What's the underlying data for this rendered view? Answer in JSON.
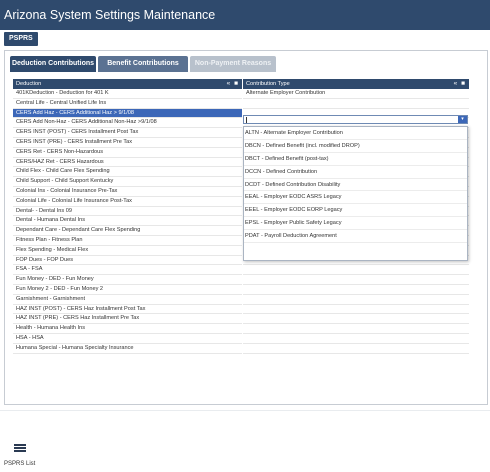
{
  "app": {
    "title": "Arizona System Settings Maintenance"
  },
  "top_tab": {
    "label": "PSPRS"
  },
  "subtabs": [
    "Deduction Contributions",
    "Benefit Contributions",
    "Non-Payment Reasons"
  ],
  "left_grid": {
    "header": "Deduction",
    "collapse_glyph": "«",
    "menu_glyph": "■",
    "rows": [
      "401KDeduction - Deduction for 401 K",
      "Central Life - Central Unified Life Ins",
      "CERS Add Haz - CERS Additional Haz > 9/1/08",
      "CERS Add Non-Haz - CERS Additional Non-Haz >9/1/08",
      "CERS INST (POST) - CERS Installment Post Tax",
      "CERS INST (PRE) - CERS Installment Pre Tax",
      "CERS Ret - CERS Non-Hazardous",
      "CERS/HAZ Ret - CERS Hazardous",
      "Child Flex - Child Care Flex Spending",
      "Child Support - Child Support Kentucky",
      "Colonial Ins - Colonial Insurance Pre-Tax",
      "Colonial Life - Colonial Life Insurance Post-Tax",
      "Dental- - Dental Ins 09",
      "Dental - Humana Dental Ins",
      "Dependant Care - Dependant Care Flex Spending",
      "Fitness Plan - Fitness Plan",
      "Flex Spending - Medical Flex",
      "FOP Dues - FOP Dues",
      "FSA - FSA",
      "Fun Money - DED - Fun Money",
      "Fun Money 2 - DED - Fun Money 2",
      "Garnishment - Garnishment",
      "HAZ INST (POST) - CERS Haz Installment Post Tax",
      "HAZ INST (PRE) - CERS Haz Installment Pre Tax",
      "Health - Humana Health Ins",
      "HSA - HSA",
      "Humana Special - Humana Specialty Insurance"
    ],
    "selected_index": 2
  },
  "right_grid": {
    "header": "Contribution Type",
    "collapse_glyph": "«",
    "menu_glyph": "■",
    "first_row": "Alternate Employer Contribution",
    "input_value": "",
    "dropdown_glyph": "▾",
    "options": [
      "ALTN - Alternate Employer Contribution",
      "DBCN - Defined Benefit (incl. modified DROP)",
      "DBCT - Defined Benefit (post-tax)",
      "DCCN - Defined Contribution",
      "DCDT - Defined Contribution Disability",
      "EEAL - Employer EODC ASRS Legacy",
      "EEEL - Employer EODC EORP Legacy",
      "EPSL - Employer Public Safety Legacy",
      "PDAT - Payroll Deduction Agreement"
    ]
  },
  "footer": {
    "list_label": "PSPRS List"
  },
  "colors": {
    "accent": "#2f4a6d",
    "selection": "#3c67b8"
  }
}
